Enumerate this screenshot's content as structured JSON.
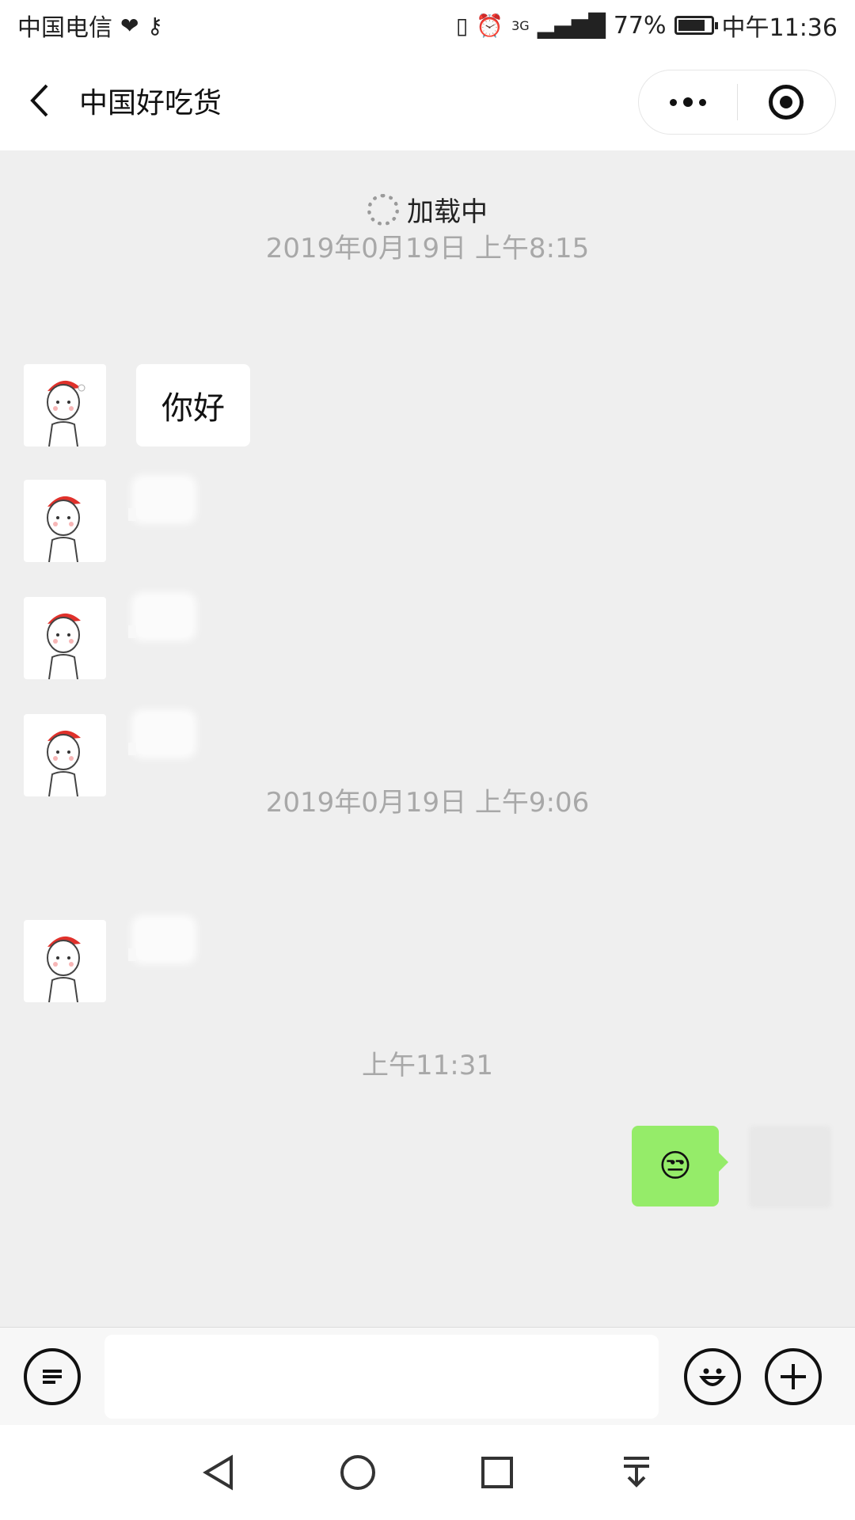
{
  "status_bar": {
    "carrier": "中国电信",
    "battery_percent": "77%",
    "battery_level": 0.77,
    "time": "中午11:36",
    "network": "3G"
  },
  "header": {
    "back_icon": "chevron-left-icon",
    "title": "中国好吃货 ",
    "more_icon": "more-dots-icon",
    "close_icon": "target-circle-icon"
  },
  "chat": {
    "loading_text": "加载中",
    "timestamps": [
      "2019年0月19日 上午8:15",
      "2019年0月19日 上午9:06",
      "上午11:31"
    ],
    "messages": [
      {
        "side": "left",
        "text": "你好"
      },
      {
        "side": "left",
        "text": ""
      },
      {
        "side": "left",
        "text": ""
      },
      {
        "side": "left",
        "text": ""
      },
      {
        "side": "left",
        "text": ""
      },
      {
        "side": "right",
        "text": "😒"
      }
    ]
  },
  "input_bar": {
    "voice_icon": "text-lines-icon",
    "input_placeholder": "",
    "emoji_icon": "smiley-icon",
    "plus_icon": "plus-circle-icon"
  },
  "nav_bar": {
    "icons": [
      "back-triangle-icon",
      "home-circle-icon",
      "recents-square-icon",
      "pull-down-icon"
    ]
  },
  "colors": {
    "my_bubble": "#95ec69",
    "background": "#efefef",
    "timestamp": "#a8a8a8"
  }
}
